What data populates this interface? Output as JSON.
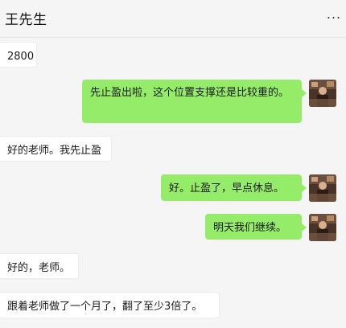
{
  "header": {
    "contact_name": "王先生",
    "more_label": "..."
  },
  "messages": [
    {
      "side": "left",
      "text": "2800"
    },
    {
      "side": "right",
      "text": "先止盈出啦，这个位置支撑还是比较重的。"
    },
    {
      "side": "left",
      "text": "好的老师。我先止盈"
    },
    {
      "side": "right",
      "text": "好。止盈了，早点休息。"
    },
    {
      "side": "right",
      "text": "明天我们继续。"
    },
    {
      "side": "left",
      "text": "好的，老师。"
    },
    {
      "side": "left",
      "text": "跟着老师做了一个月了，翻了至少3倍了。"
    }
  ],
  "colors": {
    "bg": "#f5f5f5",
    "outgoing_bubble": "#95ec69",
    "incoming_bubble": "#ffffff"
  },
  "icons": {
    "more": "more-dots-icon",
    "avatar": "user-avatar-photo"
  }
}
